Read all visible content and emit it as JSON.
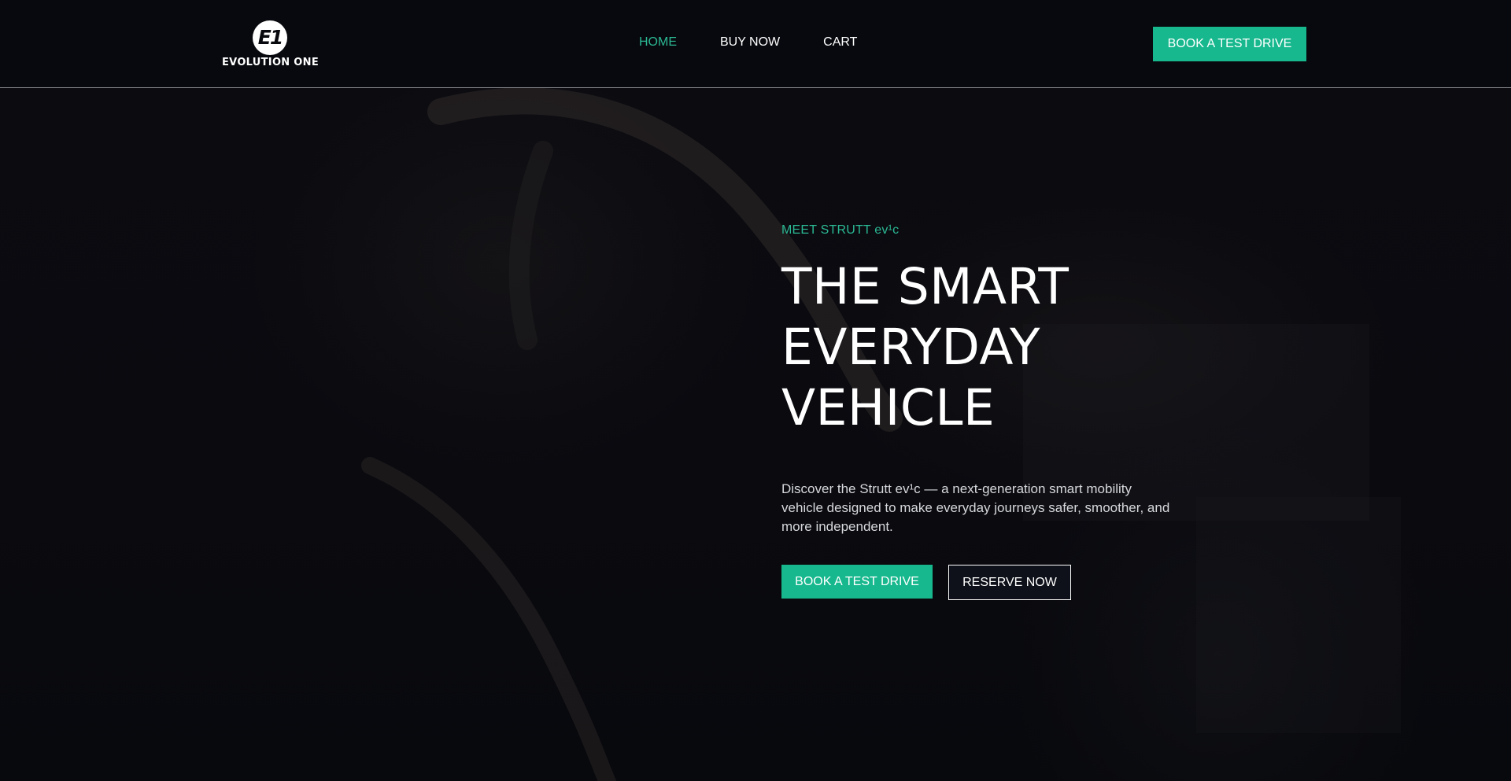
{
  "brand": {
    "logo_mark": "E1",
    "name": "EVOLUTION ONE"
  },
  "nav": {
    "items": [
      {
        "label": "HOME",
        "active": true
      },
      {
        "label": "BUY NOW",
        "active": false
      },
      {
        "label": "CART",
        "active": false
      }
    ],
    "cta_label": "BOOK A TEST DRIVE"
  },
  "hero": {
    "eyebrow": "MEET STRUTT ev¹c",
    "headline_lines": [
      "THE SMART",
      "EVERYDAY",
      "VEHICLE"
    ],
    "description": "Discover the Strutt ev¹c — a next-generation smart mobility vehicle designed to make everyday journeys safer, smoother, and more independent.",
    "primary_cta": "BOOK A TEST DRIVE",
    "secondary_cta": "RESERVE NOW"
  },
  "colors": {
    "accent": "#17b88e",
    "accent_text": "#2bb894",
    "background": "#08090e",
    "text": "#ffffff"
  }
}
